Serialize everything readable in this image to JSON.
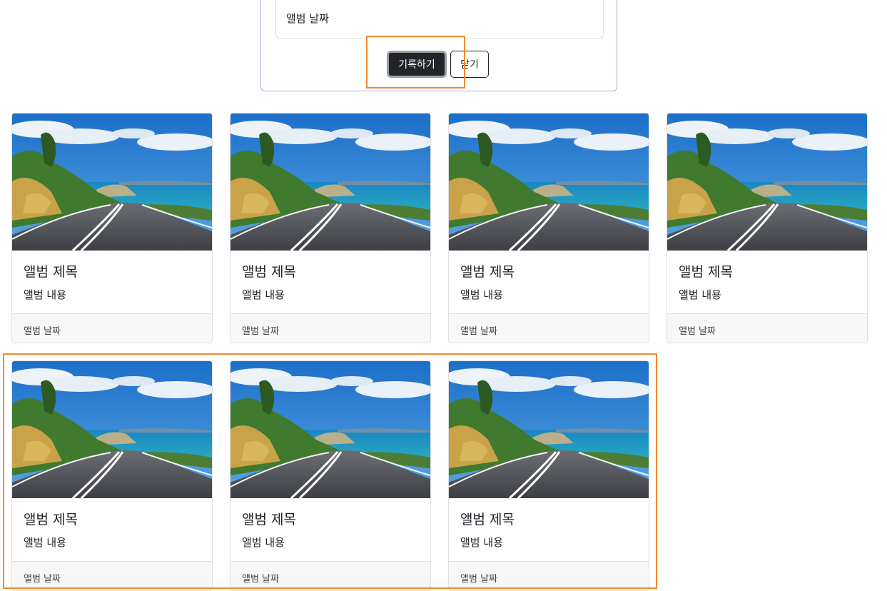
{
  "form": {
    "date_value": "앨범 날짜",
    "save_label": "기록하기",
    "close_label": "닫기"
  },
  "cards": [
    {
      "title": "앨범 제목",
      "text": "앨범 내용",
      "date": "앨범 날짜"
    },
    {
      "title": "앨범 제목",
      "text": "앨범 내용",
      "date": "앨범 날짜"
    },
    {
      "title": "앨범 제목",
      "text": "앨범 내용",
      "date": "앨범 날짜"
    },
    {
      "title": "앨범 제목",
      "text": "앨범 내용",
      "date": "앨범 날짜"
    },
    {
      "title": "앨범 제목",
      "text": "앨범 내용",
      "date": "앨범 날짜"
    },
    {
      "title": "앨범 제목",
      "text": "앨범 내용",
      "date": "앨범 날짜"
    },
    {
      "title": "앨범 제목",
      "text": "앨범 내용",
      "date": "앨범 날짜"
    }
  ],
  "colors": {
    "accent_highlight": "#f28a2e",
    "form_border": "#a9a9f5",
    "primary_button": "#212529"
  }
}
